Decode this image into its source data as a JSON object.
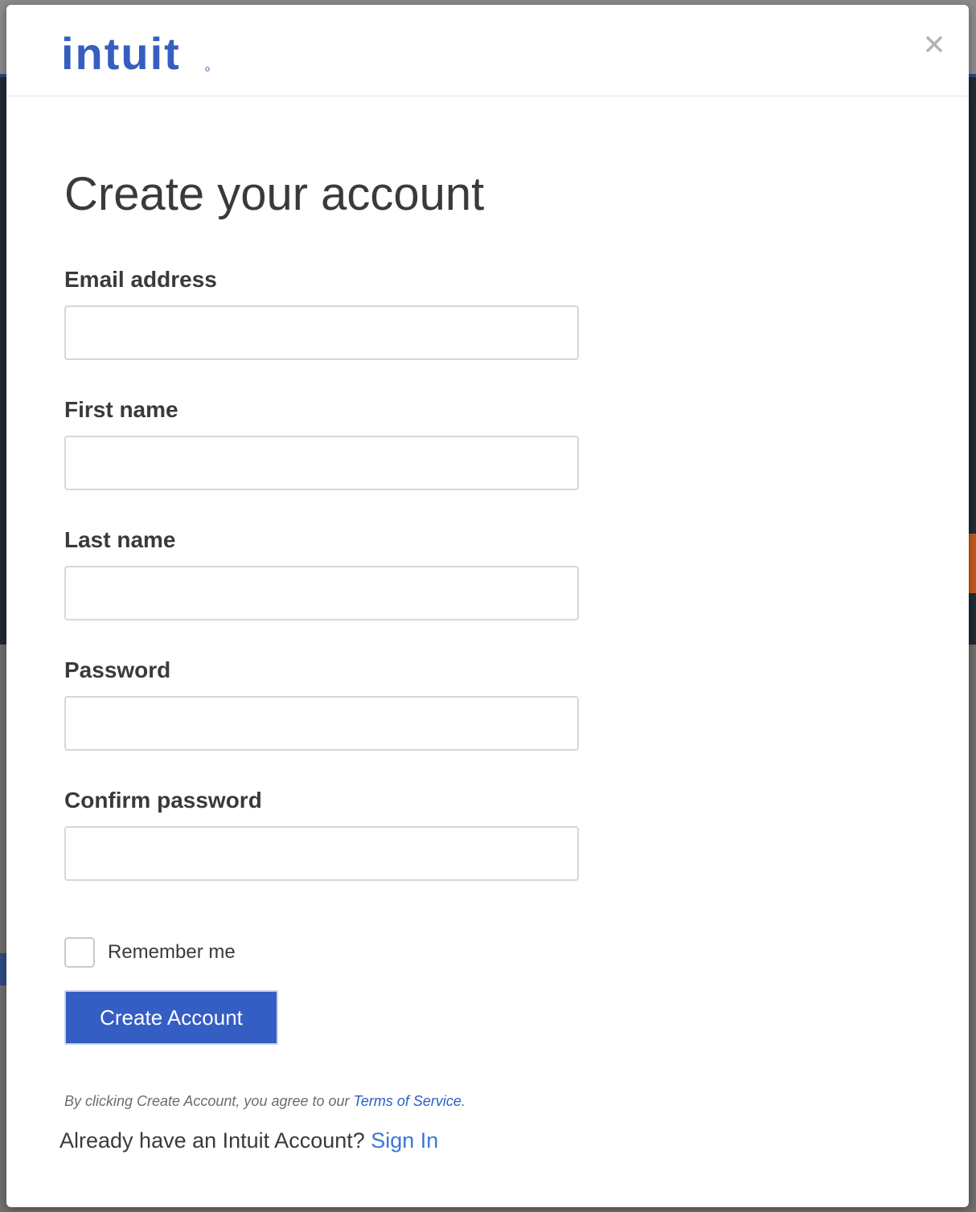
{
  "header": {
    "logo_text": "intuit",
    "close_symbol": "×"
  },
  "form": {
    "title": "Create your account",
    "fields": [
      {
        "label": "Email address",
        "value": "",
        "placeholder": ""
      },
      {
        "label": "First name",
        "value": "",
        "placeholder": ""
      },
      {
        "label": "Last name",
        "value": "",
        "placeholder": ""
      },
      {
        "label": "Password",
        "value": "",
        "placeholder": ""
      },
      {
        "label": "Confirm password",
        "value": "",
        "placeholder": ""
      }
    ],
    "remember_label": "Remember me",
    "remember_checked": false,
    "submit_label": "Create Account",
    "terms_prefix": "By clicking Create Account, you agree to our ",
    "terms_link": "Terms of Service",
    "terms_suffix": ".",
    "signin_prompt": "Already have an Intuit Account? ",
    "signin_link": "Sign In"
  },
  "colors": {
    "brand_blue": "#365ebf",
    "button_blue": "#355ec4",
    "link_blue": "#2a5fc7",
    "text_dark": "#393a3d"
  },
  "icons": {
    "close": "close-icon",
    "checkbox": "checkbox-icon"
  }
}
